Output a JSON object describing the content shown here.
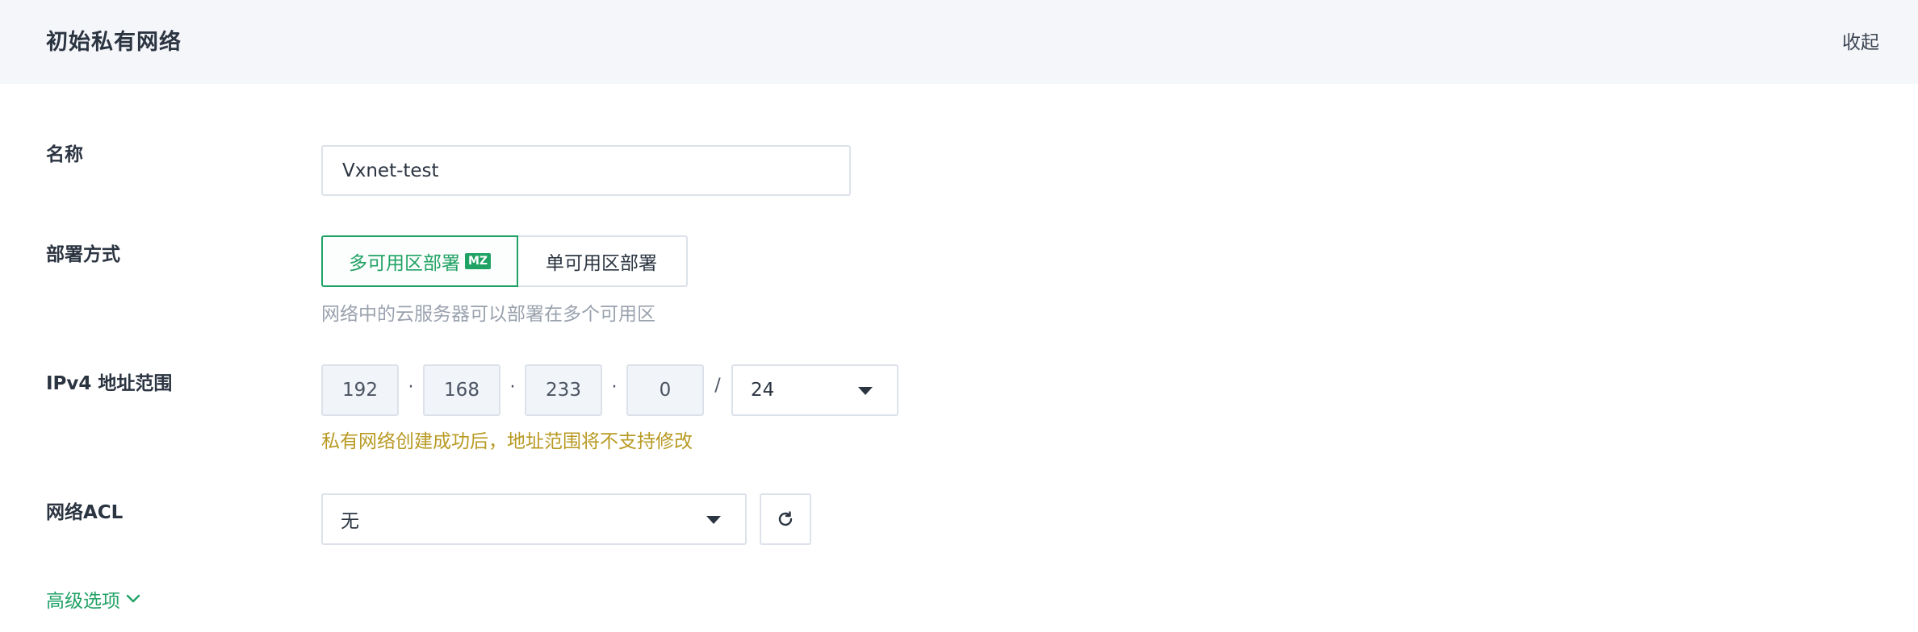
{
  "header": {
    "title": "初始私有网络",
    "collapse_label": "收起"
  },
  "form": {
    "name": {
      "label": "名称",
      "value": "Vxnet-test"
    },
    "deploy": {
      "label": "部署方式",
      "options": [
        {
          "label": "多可用区部署",
          "badge": "MZ",
          "selected": true
        },
        {
          "label": "单可用区部署",
          "selected": false
        }
      ],
      "hint": "网络中的云服务器可以部署在多个可用区"
    },
    "ipv4": {
      "label": "IPv4 地址范围",
      "octets": [
        "192",
        "168",
        "233",
        "0"
      ],
      "separator": "·",
      "slash": "/",
      "mask": "24",
      "warning": "私有网络创建成功后，地址范围将不支持修改"
    },
    "acl": {
      "label": "网络ACL",
      "value": "无",
      "refresh_icon": "refresh-icon"
    },
    "advanced_label": "高级选项"
  },
  "colors": {
    "accent": "#21a265",
    "warning": "#b89a24",
    "header_bg": "#f4f6fa",
    "border": "#dde2ea"
  }
}
